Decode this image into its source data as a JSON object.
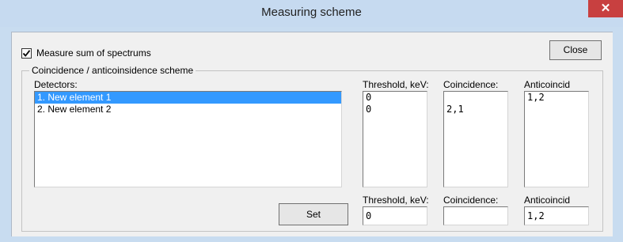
{
  "window": {
    "title": "Measuring scheme",
    "close_glyph": "✕"
  },
  "options": {
    "measure_sum_label": "Measure sum of spectrums",
    "measure_sum_checked": true
  },
  "buttons": {
    "close_label": "Close",
    "set_label": "Set"
  },
  "group": {
    "label": "Coincidence / anticoinsidence scheme",
    "detectors_label": "Detectors:",
    "detectors": [
      {
        "label": "1. New element 1",
        "selected": true
      },
      {
        "label": "2. New element 2",
        "selected": false
      }
    ],
    "threshold_label": "Threshold, keV:",
    "coincidence_label": "Coincidence:",
    "anticoincid_label": "Anticoincid",
    "threshold_values": [
      "0",
      "0"
    ],
    "coincidence_values": [
      "",
      "2,1"
    ],
    "anticoincid_values": [
      "1,2",
      ""
    ]
  },
  "editor": {
    "threshold_label": "Threshold, keV:",
    "coincidence_label": "Coincidence:",
    "anticoincid_label": "Anticoincid",
    "threshold_value": "0",
    "coincidence_value": "",
    "anticoincid_value": "1,2"
  },
  "colors": {
    "title_bar": "#c6daf0",
    "close_button": "#c84040",
    "selection": "#3399ff"
  }
}
